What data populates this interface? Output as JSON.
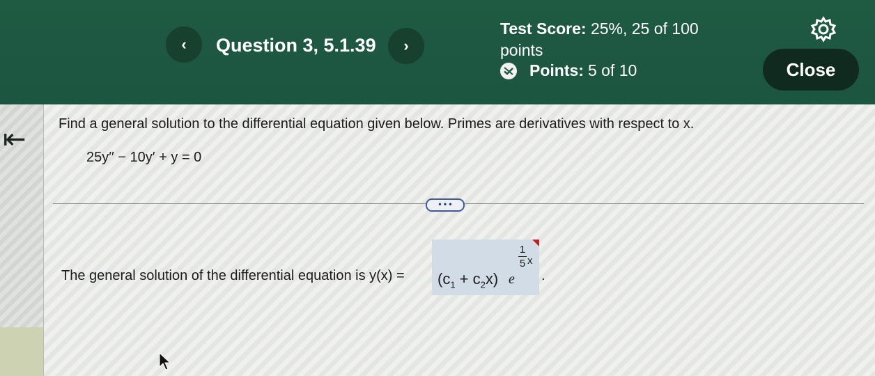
{
  "header": {
    "prev_label": "‹",
    "next_label": "›",
    "question_title": "Question 3, 5.1.39",
    "test_score_label": "Test Score:",
    "test_score_value": "25%, 25 of 100",
    "test_score_unit": "points",
    "points_label": "Points:",
    "points_value": "5 of 10",
    "close_label": "Close",
    "settings_icon": "gear-icon",
    "partial_icon": "partial-credit-icon"
  },
  "sidebar": {
    "back_icon": "back-arrow-icon",
    "back_glyph": "⇤"
  },
  "question": {
    "prompt": "Find a general solution to the differential equation given below. Primes are derivatives with respect to x.",
    "equation": "25y′′ − 10y′ + y = 0",
    "expand_label": "• • •"
  },
  "answer": {
    "prefix": "The general solution of the differential equation is y(x) =",
    "open_paren": "(",
    "c1": "c",
    "c1_sub": "1",
    "plus": " + ",
    "c2": "c",
    "c2_sub": "2",
    "x": "x",
    "close_paren": ")",
    "e": "e",
    "exp_num": "1",
    "exp_den": "5",
    "exp_var": "x",
    "period": "."
  },
  "colors": {
    "header_bg": "#1f5a43",
    "close_bg": "#102a1f",
    "answer_bg": "#d2dce6",
    "incorrect_marker": "#c0202a"
  }
}
